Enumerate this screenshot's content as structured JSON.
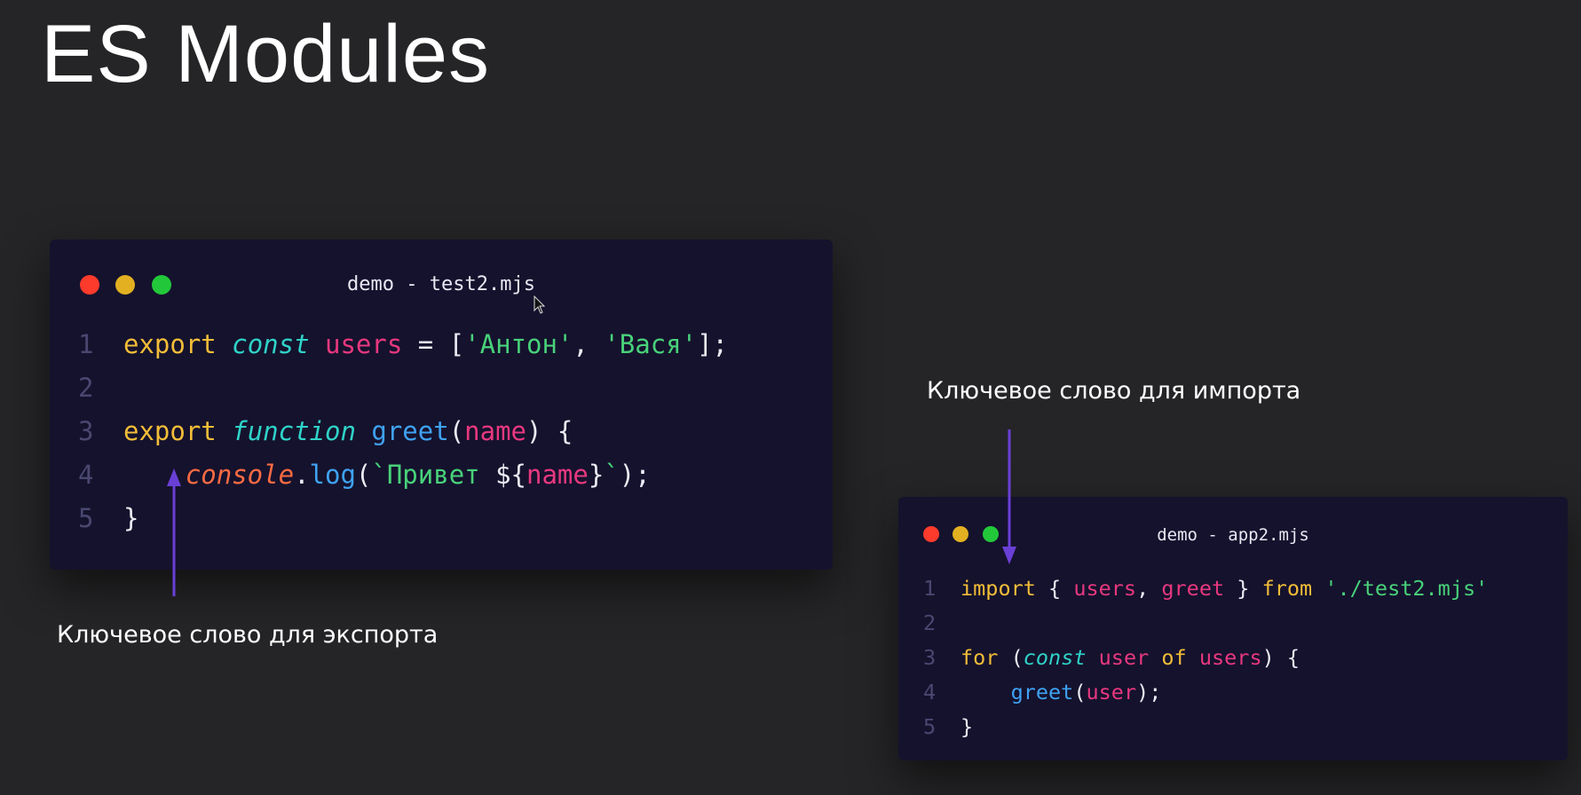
{
  "slide": {
    "title": "ES Modules"
  },
  "window_export": {
    "title": "demo - test2.mjs",
    "lines": [
      {
        "num": "1",
        "tokens": [
          [
            "kw",
            "export"
          ],
          [
            "punc",
            " "
          ],
          [
            "decl",
            "const"
          ],
          [
            "punc",
            " "
          ],
          [
            "ident",
            "users"
          ],
          [
            "punc",
            " = ["
          ],
          [
            "str",
            "'Антон'"
          ],
          [
            "punc",
            ", "
          ],
          [
            "str",
            "'Вася'"
          ],
          [
            "punc",
            "];"
          ]
        ]
      },
      {
        "num": "2",
        "tokens": []
      },
      {
        "num": "3",
        "tokens": [
          [
            "kw",
            "export"
          ],
          [
            "punc",
            " "
          ],
          [
            "decl",
            "function"
          ],
          [
            "punc",
            " "
          ],
          [
            "fn",
            "greet"
          ],
          [
            "punc",
            "("
          ],
          [
            "ident",
            "name"
          ],
          [
            "punc",
            ") {"
          ]
        ]
      },
      {
        "num": "4",
        "tokens": [
          [
            "punc",
            "    "
          ],
          [
            "obj",
            "console"
          ],
          [
            "punc",
            "."
          ],
          [
            "fn",
            "log"
          ],
          [
            "punc",
            "("
          ],
          [
            "str",
            "`Привет "
          ],
          [
            "punc",
            "${"
          ],
          [
            "ident",
            "name"
          ],
          [
            "punc",
            "}"
          ],
          [
            "str",
            "`"
          ],
          [
            "punc",
            ");"
          ]
        ]
      },
      {
        "num": "5",
        "tokens": [
          [
            "punc",
            "}"
          ]
        ]
      }
    ]
  },
  "window_import": {
    "title": "demo - app2.mjs",
    "lines": [
      {
        "num": "1",
        "tokens": [
          [
            "kw",
            "import"
          ],
          [
            "punc",
            " { "
          ],
          [
            "ident",
            "users"
          ],
          [
            "punc",
            ", "
          ],
          [
            "ident",
            "greet"
          ],
          [
            "punc",
            " } "
          ],
          [
            "kw",
            "from"
          ],
          [
            "punc",
            " "
          ],
          [
            "str",
            "'./test2.mjs'"
          ]
        ]
      },
      {
        "num": "2",
        "tokens": []
      },
      {
        "num": "3",
        "tokens": [
          [
            "kw",
            "for"
          ],
          [
            "punc",
            " ("
          ],
          [
            "decl",
            "const"
          ],
          [
            "punc",
            " "
          ],
          [
            "ident",
            "user"
          ],
          [
            "punc",
            " "
          ],
          [
            "kw",
            "of"
          ],
          [
            "punc",
            " "
          ],
          [
            "ident",
            "users"
          ],
          [
            "punc",
            ") {"
          ]
        ]
      },
      {
        "num": "4",
        "tokens": [
          [
            "punc",
            "    "
          ],
          [
            "fn",
            "greet"
          ],
          [
            "punc",
            "("
          ],
          [
            "ident",
            "user"
          ],
          [
            "punc",
            ");"
          ]
        ]
      },
      {
        "num": "5",
        "tokens": [
          [
            "punc",
            "}"
          ]
        ]
      }
    ]
  },
  "annotations": {
    "export_label": "Ключевое слово для экспорта",
    "import_label": "Ключевое слово для импорта"
  },
  "colors": {
    "background": "#252527",
    "window": "#15122d",
    "arrow": "#6a3fd6",
    "dot_red": "#fc3b2c",
    "dot_yellow": "#e2b021",
    "dot_green": "#22c83a"
  }
}
